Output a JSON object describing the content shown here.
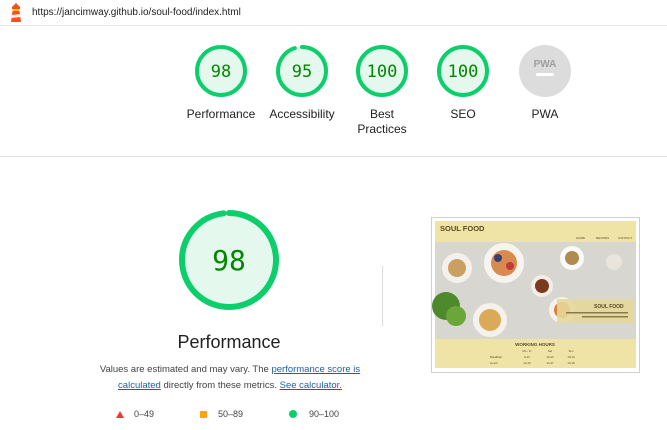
{
  "toolbar": {
    "url": "https://jancimway.github.io/soul-food/index.html"
  },
  "colors": {
    "pass": "#0cce6b",
    "pass_text": "#008800",
    "pass_fill": "#e5f8ee",
    "average": "#ffa400",
    "fail": "#ff3333",
    "pwa": "#dcdcdc"
  },
  "categories": [
    {
      "label": "Performance",
      "score": "98",
      "value": 98
    },
    {
      "label": "Accessibility",
      "score": "95",
      "value": 95
    },
    {
      "label": "Best Practices",
      "score": "100",
      "value": 100
    },
    {
      "label": "SEO",
      "score": "100",
      "value": 100
    },
    {
      "label": "PWA",
      "badge": "PWA"
    }
  ],
  "performance": {
    "score": "98",
    "value": 98,
    "title": "Performance",
    "desc_prefix": "Values are estimated and may vary. The ",
    "desc_link1": "performance score is calculated",
    "desc_middle": " directly from these metrics. ",
    "desc_link2": "See calculator."
  },
  "legend": [
    {
      "shape": "triangle",
      "label": "0–49"
    },
    {
      "shape": "square",
      "label": "50–89"
    },
    {
      "shape": "circle",
      "label": "90–100"
    }
  ],
  "screenshot": {
    "brand": "SOUL FOOD",
    "nav": [
      "HOME",
      "RECIPES",
      "CONTACT"
    ],
    "overlay_title": "SOUL FOOD",
    "hours_title": "WORKING HOURS",
    "days": [
      "Mo - Fr",
      "Sat",
      "Sun"
    ],
    "rows": [
      {
        "meal": "Breakfast",
        "times": [
          "9-12",
          "10-13",
          "10-14"
        ]
      },
      {
        "meal": "Lunch",
        "times": [
          "12-16",
          "14-17",
          "14-18"
        ]
      }
    ]
  }
}
